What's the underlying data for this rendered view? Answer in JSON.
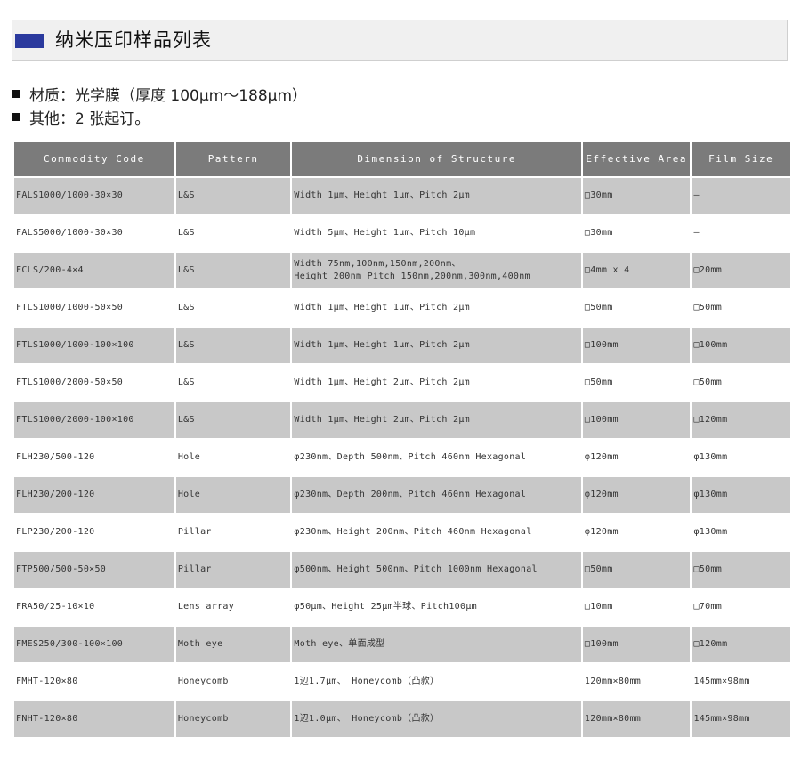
{
  "title": "纳米压印样品列表",
  "notes": [
    "材质：光学膜（厚度 100μm～188μm）",
    "其他：2 张起订。"
  ],
  "table": {
    "headers": [
      "Commodity Code",
      "Pattern",
      "Dimension of Structure",
      "Effective Area",
      "Film Size"
    ],
    "rows": [
      {
        "code": "FALS1000/1000-30×30",
        "pattern": "L&S",
        "dimension": "Width 1μm、Height 1μm、Pitch 2μm",
        "area": "□30mm",
        "film": "—"
      },
      {
        "code": "FALS5000/1000-30×30",
        "pattern": "L&S",
        "dimension": "Width 5μm、Height 1μm、Pitch 10μm",
        "area": "□30mm",
        "film": "—"
      },
      {
        "code": "FCLS/200-4×4",
        "pattern": "L&S",
        "dimension": "Width 75nm,100nm,150nm,200nm、",
        "dimension2": "Height 200nm Pitch 150nm,200nm,300nm,400nm",
        "area": "□4mm x 4",
        "film": "□20mm"
      },
      {
        "code": "FTLS1000/1000-50×50",
        "pattern": "L&S",
        "dimension": "Width 1μm、Height 1μm、Pitch 2μm",
        "area": "□50mm",
        "film": "□50mm"
      },
      {
        "code": "FTLS1000/1000-100×100",
        "pattern": "L&S",
        "dimension": "Width 1μm、Height 1μm、Pitch 2μm",
        "area": "□100mm",
        "film": "□100mm"
      },
      {
        "code": "FTLS1000/2000-50×50",
        "pattern": "L&S",
        "dimension": "Width 1μm、Height 2μm、Pitch 2μm",
        "area": "□50mm",
        "film": "□50mm"
      },
      {
        "code": "FTLS1000/2000-100×100",
        "pattern": "L&S",
        "dimension": "Width 1μm、Height 2μm、Pitch 2μm",
        "area": "□100mm",
        "film": "□120mm"
      },
      {
        "code": "FLH230/500-120",
        "pattern": "Hole",
        "dimension": "φ230nm、Depth 500nm、Pitch 460nm Hexagonal",
        "area": "φ120mm",
        "film": "φ130mm"
      },
      {
        "code": "FLH230/200-120",
        "pattern": "Hole",
        "dimension": "φ230nm、Depth 200nm、Pitch 460nm Hexagonal",
        "area": "φ120mm",
        "film": "φ130mm"
      },
      {
        "code": "FLP230/200-120",
        "pattern": "Pillar",
        "dimension": "φ230nm、Height 200nm、Pitch 460nm Hexagonal",
        "area": "φ120mm",
        "film": "φ130mm"
      },
      {
        "code": "FTP500/500-50×50",
        "pattern": "Pillar",
        "dimension": "φ500nm、Height 500nm、Pitch 1000nm Hexagonal",
        "area": "□50mm",
        "film": "□50mm"
      },
      {
        "code": "FRA50/25-10×10",
        "pattern": "Lens array",
        "dimension": "φ50μm、Height 25μm半球、Pitch100μm",
        "area": "□10mm",
        "film": "□70mm"
      },
      {
        "code": "FMES250/300-100×100",
        "pattern": "Moth eye",
        "dimension": "Moth eye、单面成型",
        "area": "□100mm",
        "film": "□120mm"
      },
      {
        "code": "FMHT-120×80",
        "pattern": "Honeycomb",
        "dimension": "1辺1.7μm、 Honeycomb（凸款）",
        "area": "120mm×80mm",
        "film": "145mm×98mm"
      },
      {
        "code": "FNHT-120×80",
        "pattern": "Honeycomb",
        "dimension": "1辺1.0μm、 Honeycomb（凸款）",
        "area": "120mm×80mm",
        "film": "145mm×98mm"
      }
    ]
  },
  "colors": {
    "title_mark": "#2b3a9e",
    "header_bg": "#7b7b7b",
    "shaded_row": "#c8c8c8"
  }
}
